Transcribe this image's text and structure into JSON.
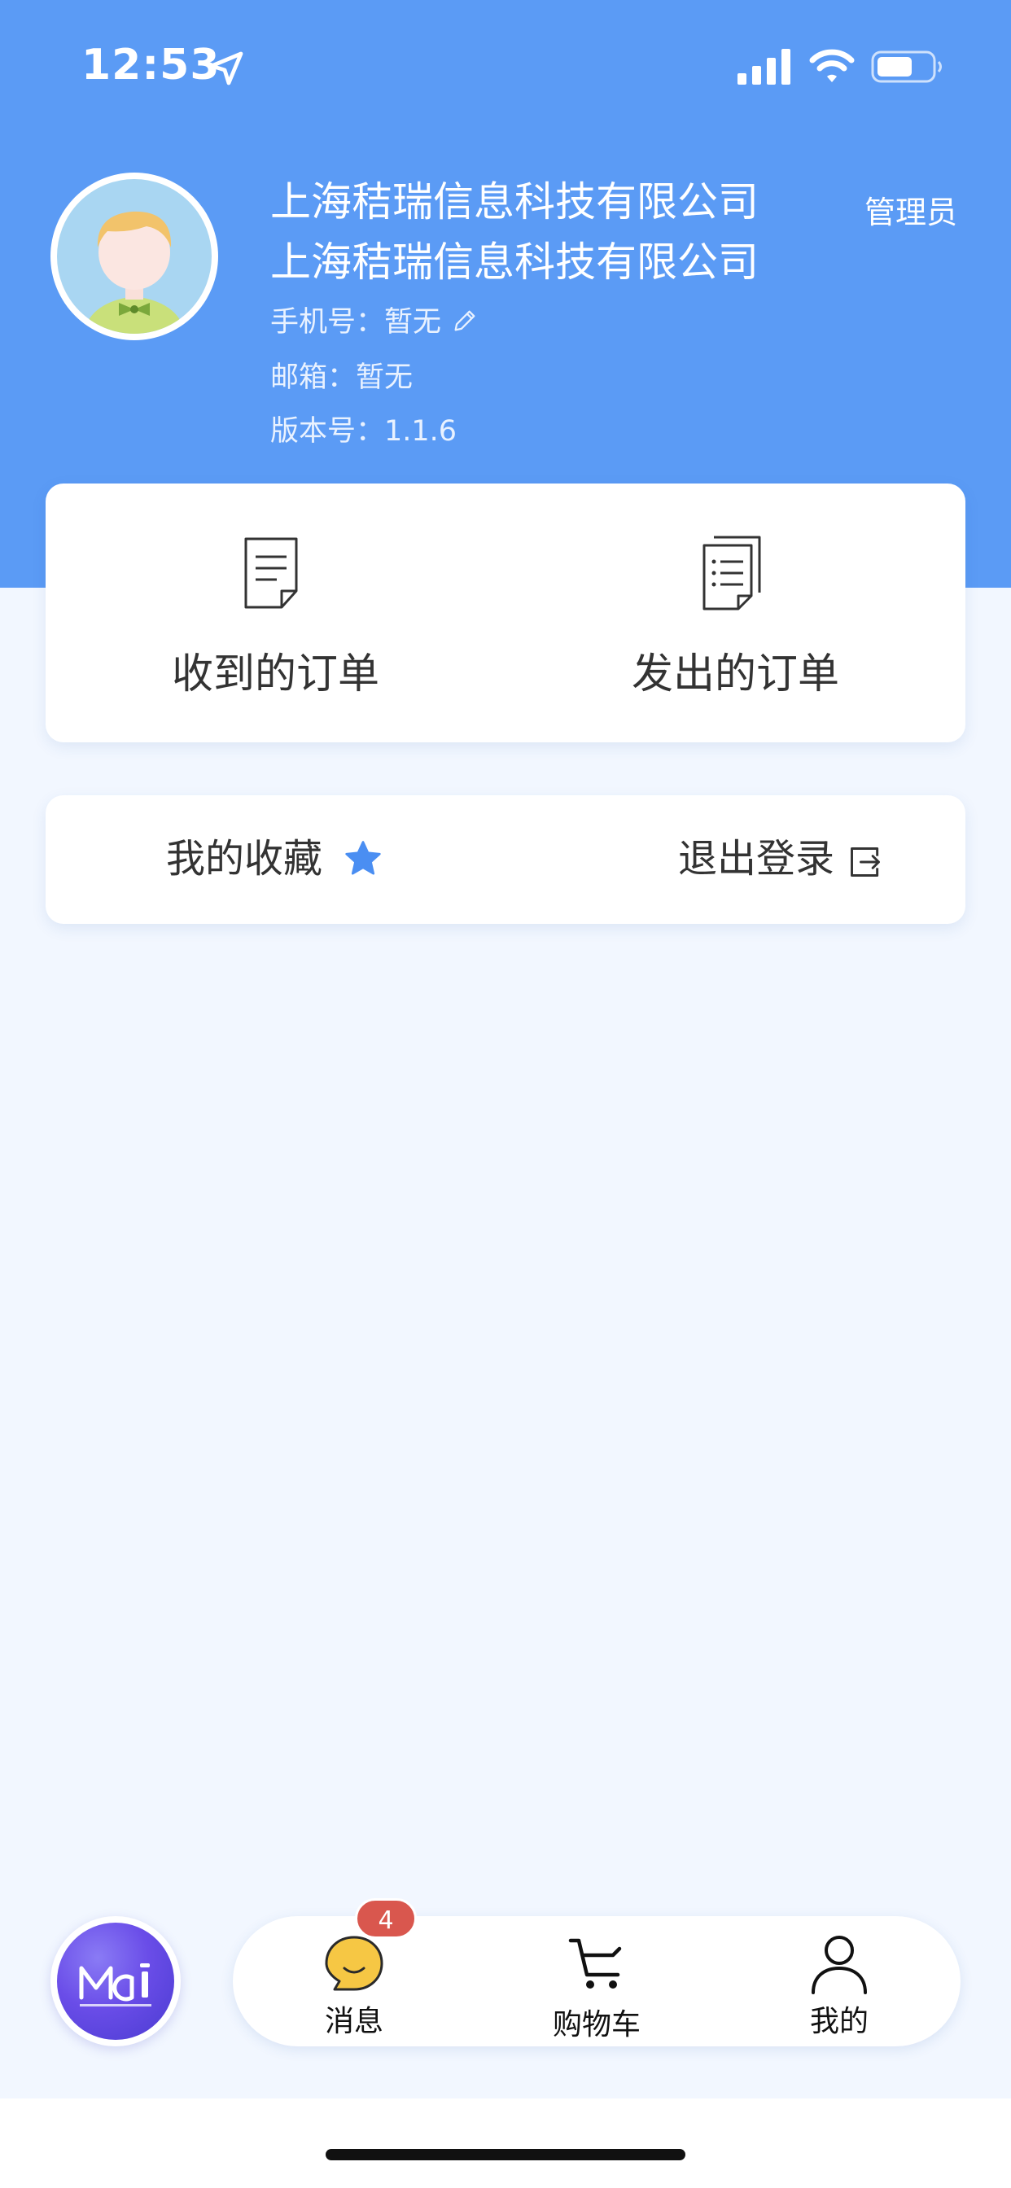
{
  "status_bar": {
    "time": "12:53",
    "icons": [
      "location-arrow-icon",
      "cellular-signal-icon",
      "wifi-icon",
      "battery-icon"
    ]
  },
  "profile": {
    "company_line_1": "上海秸瑞信息科技有限公司",
    "company_line_2": "上海秸瑞信息科技有限公司",
    "role": "管理员",
    "phone_label": "手机号：",
    "phone_value": "暂无",
    "email_label": "邮箱：",
    "email_value": "暂无",
    "version_label": "版本号：",
    "version_value": "1.1.6"
  },
  "orders": {
    "received_label": "收到的订单",
    "sent_label": "发出的订单"
  },
  "actions": {
    "favorites_label": "我的收藏",
    "logout_label": "退出登录"
  },
  "tabbar": {
    "messages_label": "消息",
    "messages_badge": "4",
    "cart_label": "购物车",
    "mine_label": "我的"
  },
  "colors": {
    "header_blue": "#5B9BF5",
    "page_background": "#F2F7FF",
    "accent_star": "#4A8EF2",
    "badge_red": "#D9574E",
    "message_icon_yellow": "#F6C744"
  }
}
